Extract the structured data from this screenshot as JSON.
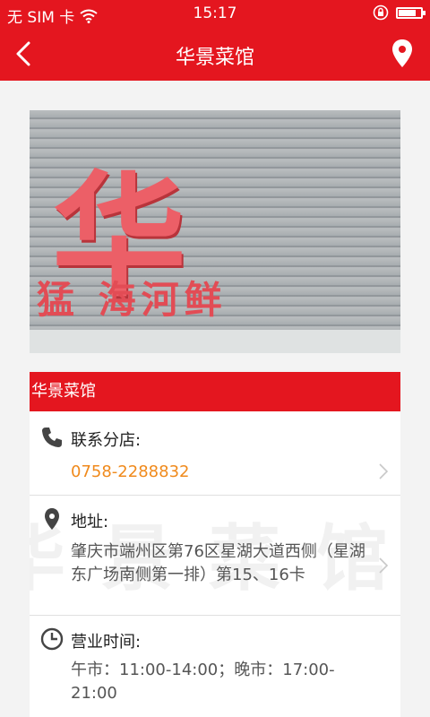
{
  "status_bar": {
    "carrier": "无 SIM 卡",
    "time": "15:17",
    "battery_level": 0.85
  },
  "nav": {
    "title": "华景菜馆",
    "back_icon": "chevron-left-icon",
    "location_icon": "map-pin-icon"
  },
  "photo": {
    "big_text": "华景",
    "small_text": "猛 海河鲜"
  },
  "card": {
    "header": "华景菜馆",
    "watermark": "华景菜馆",
    "contact": {
      "label": "联系分店:",
      "value": "0758-2288832"
    },
    "address": {
      "label": "地址:",
      "value": "肇庆市端州区第76区星湖大道西侧（星湖东广场南侧第一排）第15、16卡"
    },
    "hours": {
      "label": "营业时间:",
      "value": "午市：11:00-14:00；晚市：17:00-21:00"
    }
  },
  "colors": {
    "brand_red": "#e4161f",
    "phone_orange": "#f08a1c"
  }
}
